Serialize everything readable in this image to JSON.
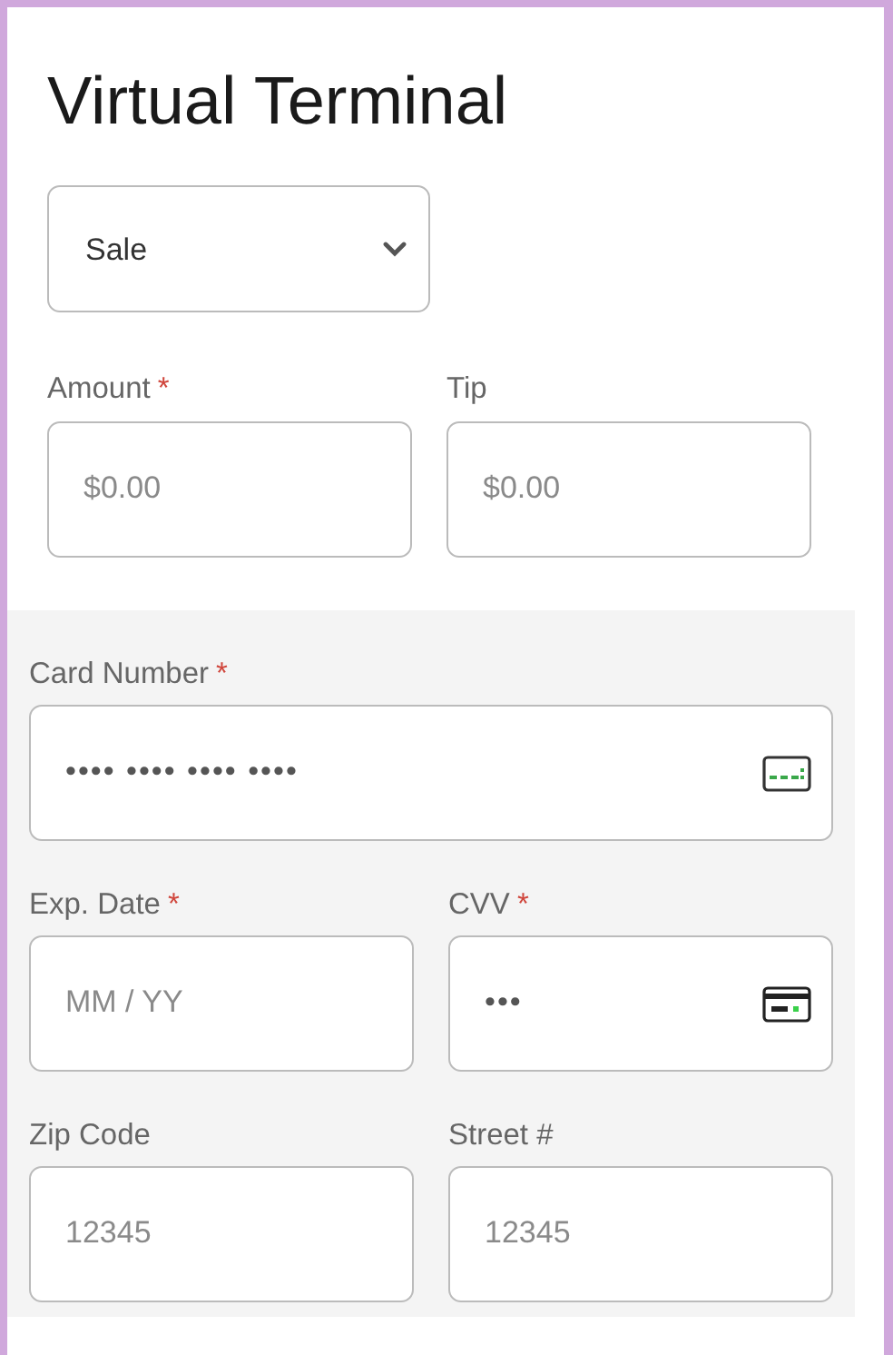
{
  "title": "Virtual Terminal",
  "transaction_type": {
    "value": "Sale"
  },
  "amount_fields": [
    {
      "label": "Amount",
      "required_mark": "*",
      "placeholder": "$0.00"
    },
    {
      "label": "Tip",
      "placeholder": "$0.00"
    }
  ],
  "card_section": {
    "rows": [
      [
        {
          "kind": "card-number",
          "label": "Card Number",
          "required_mark": "*",
          "placeholder": "•••• •••• •••• ••••"
        }
      ],
      [
        {
          "kind": "text",
          "label": "Exp. Date",
          "required_mark": "*",
          "placeholder": "MM / YY"
        },
        {
          "kind": "cvv",
          "label": "CVV",
          "required_mark": "*",
          "placeholder": "•••"
        }
      ],
      [
        {
          "kind": "text",
          "label": "Zip Code",
          "placeholder": "12345"
        },
        {
          "kind": "text",
          "label": "Street #",
          "placeholder": "12345"
        }
      ]
    ]
  }
}
